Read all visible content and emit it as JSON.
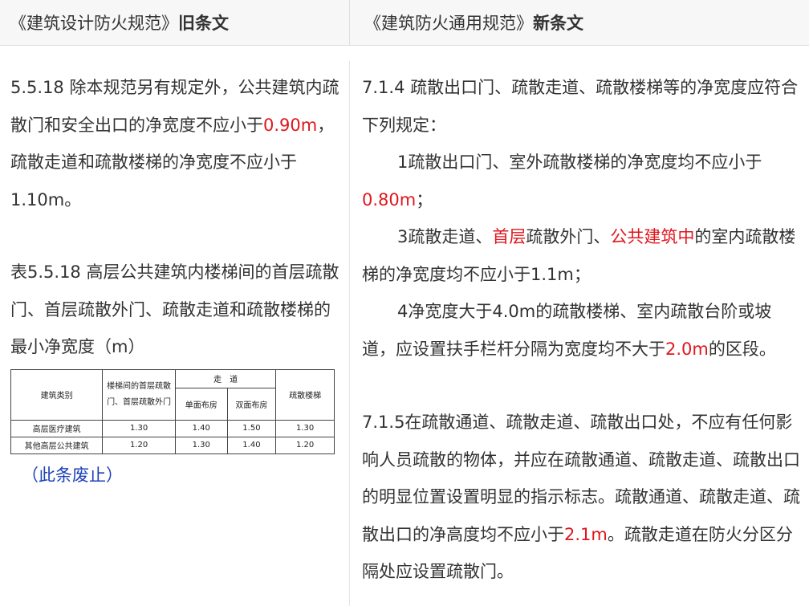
{
  "header": {
    "left_title": "《建筑设计防火规范》",
    "left_tag": "旧条文",
    "right_title": "《建筑防火通用规范》",
    "right_tag": "新条文"
  },
  "left": {
    "clause_a": "5.5.18 除本规范另有规定外，公共建筑内疏散门和安全出口的净宽度不应小于",
    "clause_red": "0.90m",
    "clause_b": "，疏散走道和疏散楼梯的净宽度不应小于1.10m。",
    "table_caption": "表5.5.18 高层公共建筑内楼梯间的首层疏散门、首层疏散外门、疏散走道和疏散楼梯的最小净宽度（m）",
    "table": {
      "h_category": "建筑类别",
      "h_door": "楼梯间的首层疏散门、首层疏散外门",
      "h_corridor": "走　道",
      "h_single": "单面布房",
      "h_double": "双面布房",
      "h_stairs": "疏散楼梯",
      "rows": [
        {
          "name": "高层医疗建筑",
          "door": "1.30",
          "single": "1.40",
          "double": "1.50",
          "stairs": "1.30"
        },
        {
          "name": "其他高层公共建筑",
          "door": "1.20",
          "single": "1.30",
          "double": "1.40",
          "stairs": "1.20"
        }
      ]
    },
    "abolished": "（此条废止）"
  },
  "right": {
    "c714_intro": "7.1.4 疏散出口门、疏散走道、疏散楼梯等的净宽度应符合下列规定：",
    "item1_a": "1疏散出口门、室外疏散楼梯的净宽度均不应小于",
    "item1_red": "0.80m",
    "item1_b": "；",
    "item3_a": "3疏散走道、",
    "item3_red1": "首层",
    "item3_b": "疏散外门、",
    "item3_red2": "公共建筑中",
    "item3_c": "的室内疏散楼梯的净宽度均不应小于1.1m；",
    "item4_a": "4净宽度大于4.0m的疏散楼梯、室内疏散台阶或坡道，应设置扶手栏杆分隔为宽度均不大于",
    "item4_red": "2.0m",
    "item4_b": "的区段。",
    "c715_a": "7.1.5在疏散通道、疏散走道、疏散出口处，不应有任何影响人员疏散的物体，并应在疏散通道、疏散走道、疏散出口的明显位置设置明显的指示标志。疏散通道、疏散走道、疏散出口的净高度均不应小于",
    "c715_red": "2.1m",
    "c715_b": "。疏散走道在防火分区分隔处应设置疏散门。"
  },
  "colors": {
    "highlight_red": "#e0161c",
    "link_blue": "#1a3fb8"
  }
}
